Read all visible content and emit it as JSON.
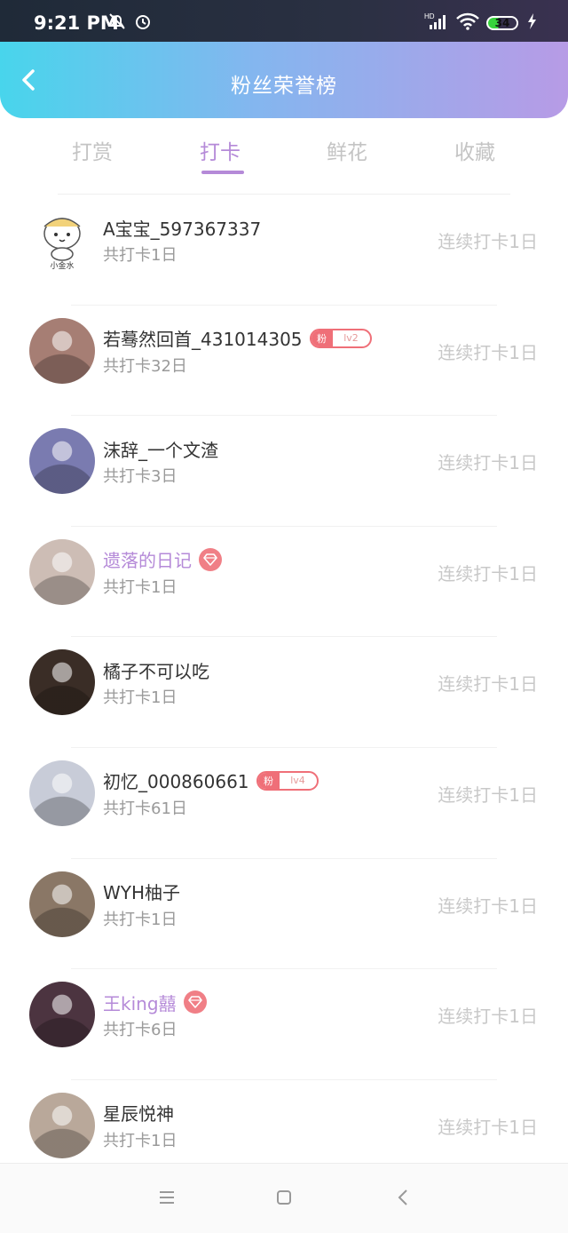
{
  "status_bar": {
    "time": "9:21 PM",
    "icons": [
      "mute-bell-icon",
      "alarm-icon",
      "hd-signal-icon",
      "wifi-icon",
      "battery-icon",
      "charging-icon"
    ],
    "battery": "34"
  },
  "header": {
    "title": "粉丝荣誉榜",
    "gradient": [
      "#48d5ec",
      "#84b6ef",
      "#b79be6"
    ]
  },
  "tabs": [
    {
      "label": "打赏",
      "active": false
    },
    {
      "label": "打卡",
      "active": true
    },
    {
      "label": "鲜花",
      "active": false
    },
    {
      "label": "收藏",
      "active": false
    }
  ],
  "accent_color": "#b58ad8",
  "users": [
    {
      "name": "A宝宝_597367337",
      "total": "共打卡1日",
      "streak": "连续打卡1日",
      "badge": null,
      "avatar_color": "#ffffff",
      "avatar_caption": "小金水"
    },
    {
      "name": "若蓦然回首_431014305",
      "total": "共打卡32日",
      "streak": "连续打卡1日",
      "badge": {
        "type": "fan",
        "key": "粉",
        "level": "lv2"
      },
      "avatar_color": "#a67e74"
    },
    {
      "name": "沫辞_一个文渣",
      "total": "共打卡3日",
      "streak": "连续打卡1日",
      "badge": null,
      "avatar_color": "#7a7bb0"
    },
    {
      "name": "遗落的日记",
      "total": "共打卡1日",
      "streak": "连续打卡1日",
      "badge": {
        "type": "gem"
      },
      "vip": true,
      "avatar_color": "#cdbdb5"
    },
    {
      "name": "橘子不可以吃",
      "total": "共打卡1日",
      "streak": "连续打卡1日",
      "badge": null,
      "avatar_color": "#3a2d26"
    },
    {
      "name": "初忆_000860661",
      "total": "共打卡61日",
      "streak": "连续打卡1日",
      "badge": {
        "type": "fan",
        "key": "粉",
        "level": "lv4"
      },
      "avatar_color": "#c8ccd8"
    },
    {
      "name": "WYH柚子",
      "total": "共打卡1日",
      "streak": "连续打卡1日",
      "badge": null,
      "avatar_color": "#8a7766"
    },
    {
      "name": "王king囍",
      "total": "共打卡6日",
      "streak": "连续打卡1日",
      "badge": {
        "type": "gem"
      },
      "vip": true,
      "avatar_color": "#4c3440"
    },
    {
      "name": "星辰悦神",
      "total": "共打卡1日",
      "streak": "连续打卡1日",
      "badge": null,
      "avatar_color": "#b9a89a"
    }
  ],
  "nav_bar": {
    "icons": [
      "menu-icon",
      "home-square-icon",
      "back-chevron-icon"
    ]
  }
}
